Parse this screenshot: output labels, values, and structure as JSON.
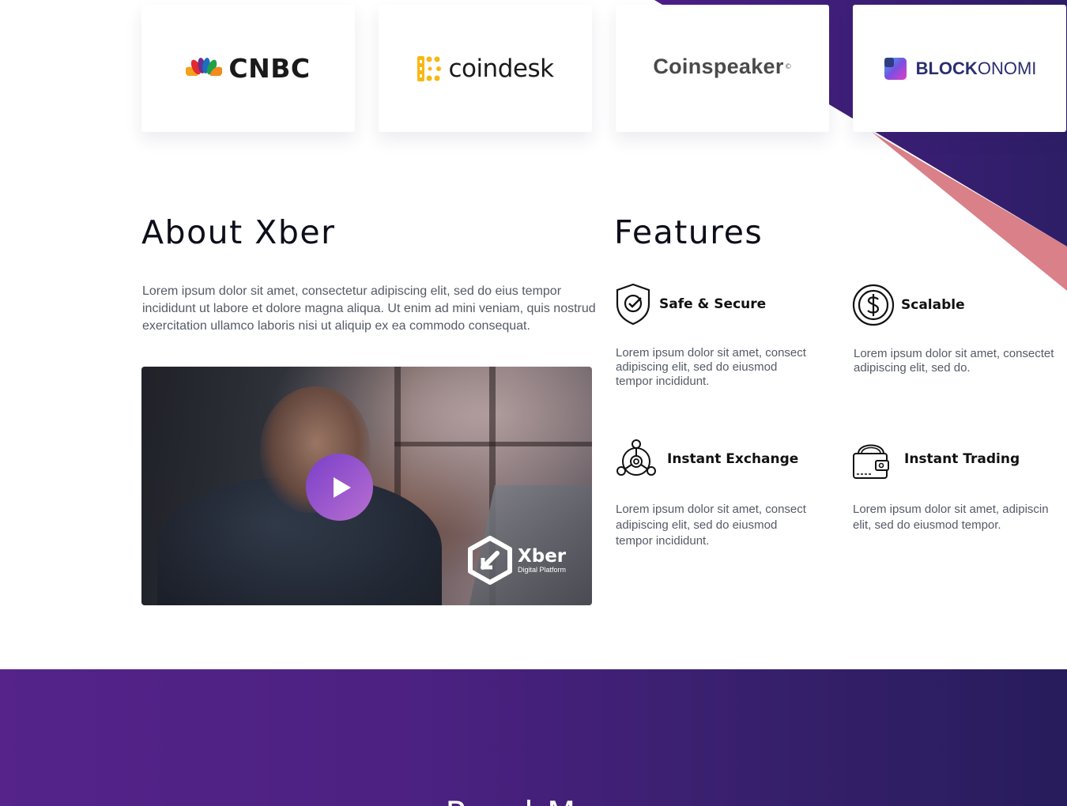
{
  "press": {
    "logos": [
      {
        "name": "CNBC",
        "text": "CNBC"
      },
      {
        "name": "coindesk",
        "text": "coindesk"
      },
      {
        "name": "Coinspeaker",
        "text": "Coinspeaker",
        "mark": "©"
      },
      {
        "name": "BLOCKONOMI",
        "bold": "BLOCK",
        "light": "ONOMI"
      }
    ]
  },
  "about": {
    "title": "About Xber",
    "text": "Lorem ipsum dolor sit amet, consectetur adipiscing elit, sed do eius tempor incididunt ut labore et dolore magna aliqua. Ut enim ad mini veniam, quis nostrud exercitation ullamco laboris nisi ut aliquip ex ea commodo consequat.",
    "video": {
      "brand": "Xber",
      "brand_sub": "Digital Platform"
    }
  },
  "features": {
    "title": "Features",
    "items": [
      {
        "title": "Safe & Secure",
        "icon": "shield-check-icon",
        "desc": [
          "Lorem ipsum dolor sit amet, consect",
          "adipiscing elit, sed do eiusmod",
          "tempor incididunt."
        ]
      },
      {
        "title": "Scalable",
        "icon": "dollar-coin-icon",
        "desc": [
          "Lorem ipsum dolor sit amet, consectet",
          "adipiscing elit, sed do."
        ]
      },
      {
        "title": "Instant Exchange",
        "icon": "network-exchange-icon",
        "desc": [
          "Lorem ipsum dolor sit amet, consect",
          "adipiscing elit, sed do eiusmod",
          "tempor incididunt."
        ]
      },
      {
        "title": "Instant Trading",
        "icon": "wallet-icon",
        "desc": [
          "Lorem ipsum dolor sit amet, adipiscin",
          "elit, sed do eiusmod tempor."
        ]
      }
    ]
  },
  "roadmap": {
    "title": "Road Map"
  },
  "colors": {
    "purple_dark": "#2b1f63",
    "purple_mid": "#4a1f86",
    "pink_accent": "#d98088",
    "play_gradient": [
      "#7a3fc9",
      "#b86fd1"
    ]
  }
}
